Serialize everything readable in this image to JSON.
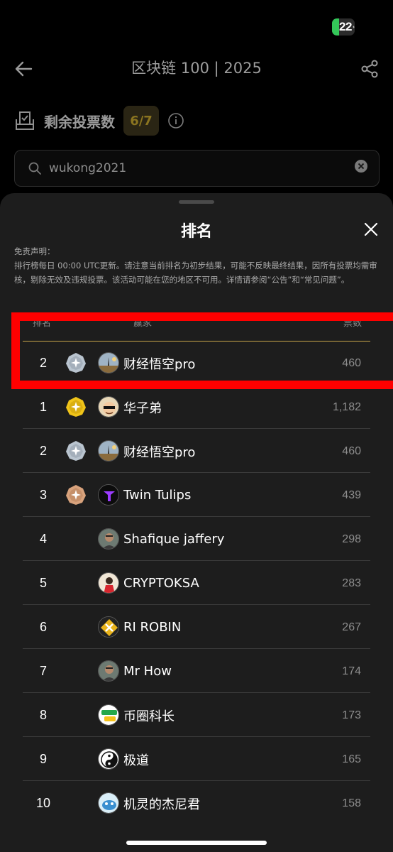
{
  "status_bar": {
    "battery_level": "22"
  },
  "header": {
    "title": "区块链 100 | 2025"
  },
  "votes": {
    "label": "剩余投票数",
    "count": "6/7"
  },
  "search": {
    "value": "wukong2021"
  },
  "sheet": {
    "title": "排名",
    "disclaimer_title": "免责声明：",
    "disclaimer_text": "排行榜每日 00:00 UTC更新。请注意当前排名为初步结果，可能不反映最终结果，因所有投票均需审核，剔除无效及违规投票。该活动可能在您的地区不可用。详情请参阅“公告”和“常见问题”。",
    "headers": {
      "rank": "排名",
      "creator": "赢家",
      "votes": "票数"
    }
  },
  "my_row": {
    "rank": "2",
    "medal": "silver",
    "name": "财经悟空pro",
    "votes": "460",
    "avatar": "landscape"
  },
  "rows": [
    {
      "rank": "1",
      "medal": "gold",
      "name": "华子弟",
      "votes": "1,182",
      "avatar": "face-cartoon"
    },
    {
      "rank": "2",
      "medal": "silver",
      "name": "财经悟空pro",
      "votes": "460",
      "avatar": "landscape"
    },
    {
      "rank": "3",
      "medal": "bronze",
      "name": "Twin Tulips",
      "votes": "439",
      "avatar": "purple-logo"
    },
    {
      "rank": "4",
      "medal": "",
      "name": "Shafique jaffery",
      "votes": "298",
      "avatar": "person"
    },
    {
      "rank": "5",
      "medal": "",
      "name": "CRYPTOKSA",
      "votes": "283",
      "avatar": "red-figure"
    },
    {
      "rank": "6",
      "medal": "",
      "name": "RI ROBIN",
      "votes": "267",
      "avatar": "yellow-logo"
    },
    {
      "rank": "7",
      "medal": "",
      "name": "Mr How",
      "votes": "174",
      "avatar": "person"
    },
    {
      "rank": "8",
      "medal": "",
      "name": "币圈科长",
      "votes": "173",
      "avatar": "green-text"
    },
    {
      "rank": "9",
      "medal": "",
      "name": "极道",
      "votes": "165",
      "avatar": "yin-yang"
    },
    {
      "rank": "10",
      "medal": "",
      "name": "机灵的杰尼君",
      "votes": "158",
      "avatar": "blue-creature"
    }
  ],
  "colors": {
    "gold": "#f0c419",
    "silver": "#b9c4cf",
    "bronze": "#d8a27c",
    "accent_line": "#c9a64a",
    "highlight": "#ff0000"
  }
}
